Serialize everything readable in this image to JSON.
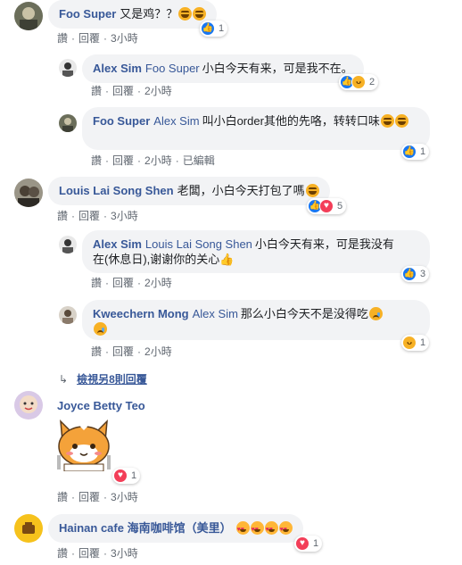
{
  "labels": {
    "like": "讚",
    "reply": "回覆",
    "edited": "已編輯"
  },
  "colors": {
    "name": "#385898",
    "bubble": "#f2f3f5",
    "meta": "#606770",
    "like_blue": "#1877f2",
    "haha_yellow": "#f7b125",
    "love_red": "#f33e58"
  },
  "comments": [
    {
      "author": "Foo Super",
      "text": "又是鸡？？",
      "emojis": [
        "laugh",
        "laugh"
      ],
      "time": "3小時",
      "reactions": [
        "like"
      ],
      "count": "1"
    },
    {
      "author": "Alex Sim",
      "tag": "Foo Super",
      "text": "小白今天有来，可是我不在。",
      "time": "2小時",
      "reactions": [
        "like",
        "haha"
      ],
      "count": "2"
    },
    {
      "author": "Foo Super",
      "tag": "Alex Sim",
      "text": "叫小白order其他的先咯，转转口味",
      "emojis": [
        "laugh",
        "laugh"
      ],
      "time": "2小時",
      "edited": true,
      "reactions": [
        "like"
      ],
      "count": "1"
    },
    {
      "author": "Louis Lai Song Shen",
      "text": "老闆，小白今天打包了嗎",
      "emojis": [
        "laugh"
      ],
      "time": "3小時",
      "reactions": [
        "like",
        "love"
      ],
      "count": "5"
    },
    {
      "author": "Alex Sim",
      "tag": "Louis Lai Song Shen",
      "text_line1": "小白今天有来，可是我没有",
      "text_line2": "在(休息日),谢谢你的关心",
      "time": "2小時",
      "reactions": [
        "like"
      ],
      "count": "3"
    },
    {
      "author": "Kweechern Mong",
      "tag": "Alex Sim",
      "text": "那么小白今天不是没得吃",
      "emojis": [
        "cry",
        "cry"
      ],
      "time": "2小時",
      "reactions": [
        "haha"
      ],
      "count": "1"
    },
    {
      "author": "Joyce Betty Teo",
      "time": "3小時",
      "reactions": [
        "love"
      ],
      "count": "1"
    },
    {
      "author": "Hainan cafe 海南咖啡馆（美里）",
      "emojis": [
        "heart-eyes",
        "heart-eyes",
        "heart-eyes",
        "heart-eyes"
      ],
      "time": "3小時",
      "reactions": [
        "love"
      ],
      "count": "1"
    }
  ],
  "more_replies": "檢視另8則回覆",
  "icons": {
    "like": "thumbs-up-icon",
    "haha": "laughing-face-icon",
    "love": "heart-icon",
    "arrow": "reply-arrow-icon",
    "sticker": "cat-sticker"
  }
}
